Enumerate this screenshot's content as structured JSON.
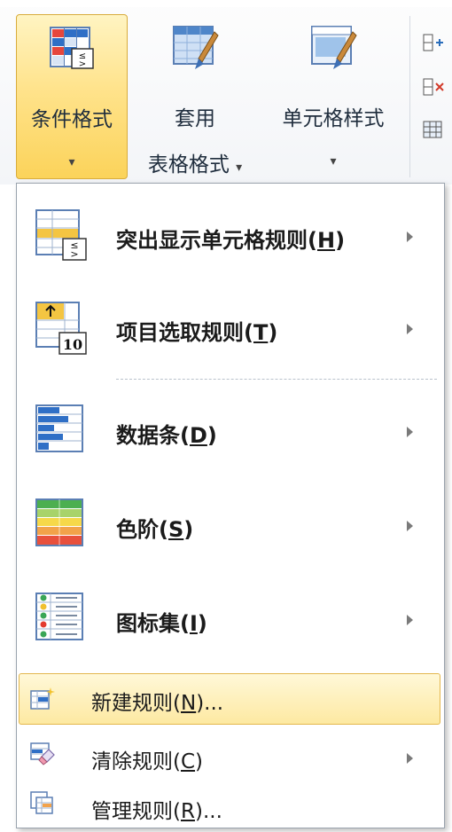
{
  "ribbon": {
    "conditional_format": {
      "label": "条件格式",
      "arrow": "▾"
    },
    "format_as_table": {
      "label_line1": "套用",
      "label_line2": "表格格式",
      "arrow": "▾"
    },
    "cell_styles": {
      "label": "单元格样式",
      "arrow": "▾"
    }
  },
  "menu": {
    "items": [
      {
        "label": "突出显示单元格规则(",
        "key": "H",
        "tail": ")",
        "has_submenu": true,
        "icon": "highlight-cells-icon"
      },
      {
        "label": "项目选取规则(",
        "key": "T",
        "tail": ")",
        "has_submenu": true,
        "icon": "top-bottom-icon",
        "icon_text": "10"
      },
      {
        "label": "数据条(",
        "key": "D",
        "tail": ")",
        "has_submenu": true,
        "icon": "data-bars-icon"
      },
      {
        "label": "色阶(",
        "key": "S",
        "tail": ")",
        "has_submenu": true,
        "icon": "color-scales-icon"
      },
      {
        "label": "图标集(",
        "key": "I",
        "tail": ")",
        "has_submenu": true,
        "icon": "icon-sets-icon"
      },
      {
        "label": "新建规则(",
        "key": "N",
        "tail": ")...",
        "has_submenu": false,
        "icon": "new-rule-icon",
        "highlighted": true
      },
      {
        "label": "清除规则(",
        "key": "C",
        "tail": ")",
        "has_submenu": true,
        "icon": "clear-rules-icon"
      },
      {
        "label": "管理规则(",
        "key": "R",
        "tail": ")...",
        "has_submenu": false,
        "icon": "manage-rules-icon"
      }
    ]
  },
  "colors": {
    "active_button_top": "#fff4c2",
    "active_button_bottom": "#fbd35a",
    "highlight_border": "#e3b74d"
  }
}
